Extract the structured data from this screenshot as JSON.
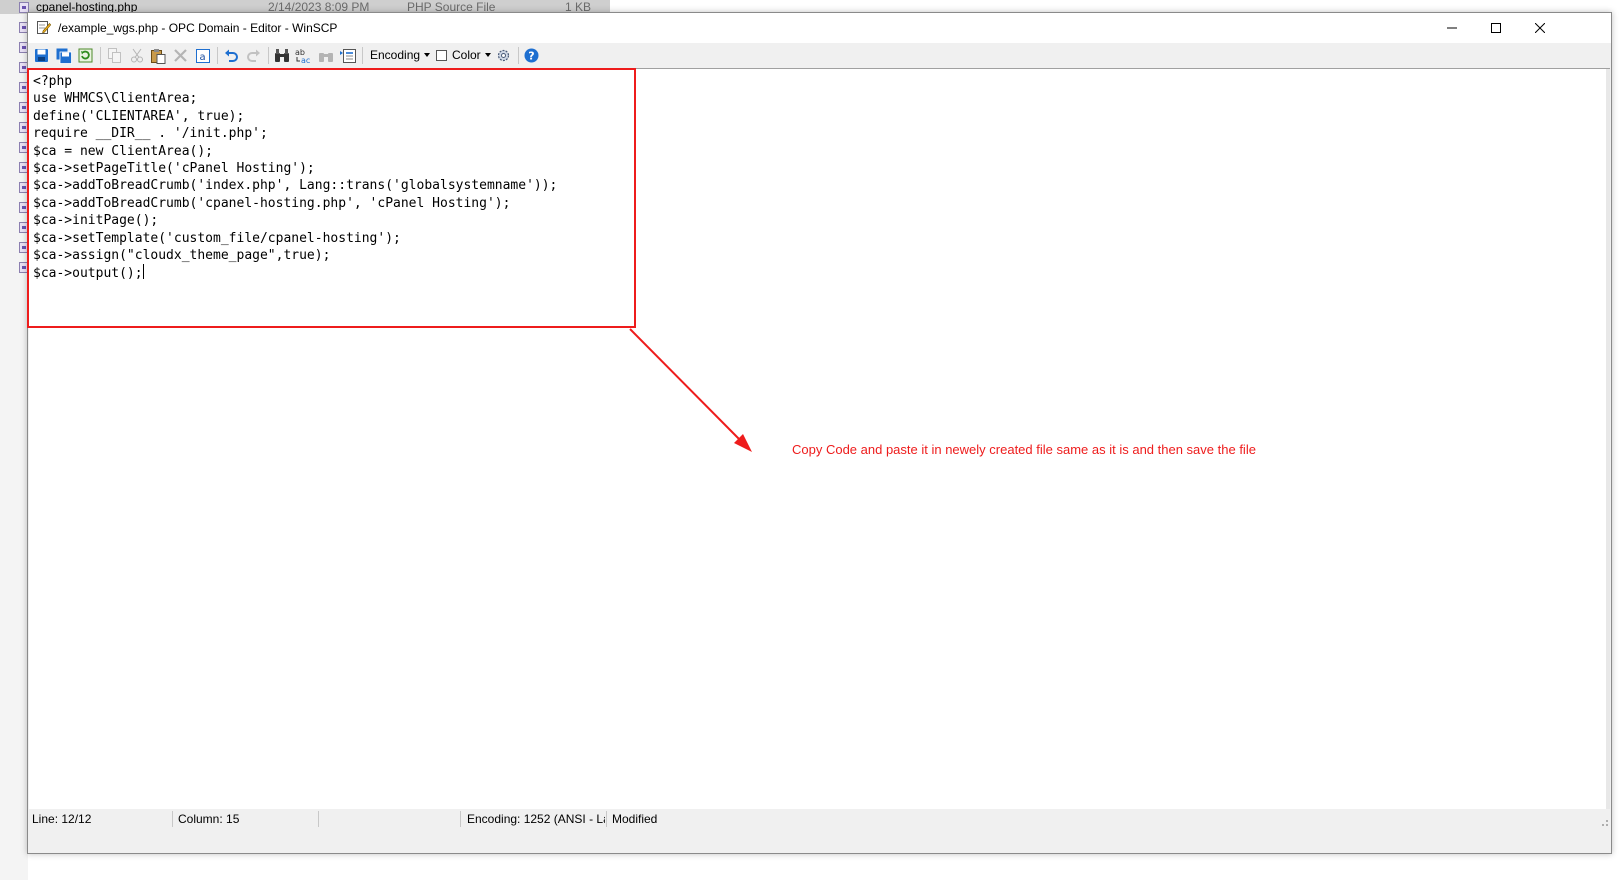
{
  "background_file": {
    "name": "cpanel-hosting.php",
    "modified": "2/14/2023 8:09 PM",
    "type": "PHP Source File",
    "size": "1 KB"
  },
  "window": {
    "title": "/example_wgs.php - OPC Domain - Editor - WinSCP",
    "controls": {
      "minimize": "minimize-icon",
      "maximize": "maximize-icon",
      "close": "close-icon"
    }
  },
  "toolbar": {
    "encoding_label": "Encoding",
    "color_label": "Color",
    "buttons": [
      "save-icon",
      "save-all-icon",
      "reload-icon",
      "copy-icon",
      "cut-icon",
      "paste-icon",
      "delete-icon",
      "select-all-icon",
      "undo-icon",
      "redo-icon",
      "find-icon",
      "replace-icon",
      "find-next-icon",
      "go-to-line-icon",
      "preferences-icon",
      "help-icon"
    ]
  },
  "editor": {
    "lines": [
      "<?php",
      "use WHMCS\\ClientArea;",
      "define('CLIENTAREA', true);",
      "require __DIR__ . '/init.php';",
      "$ca = new ClientArea();",
      "$ca->setPageTitle('cPanel Hosting');",
      "$ca->addToBreadCrumb('index.php', Lang::trans('globalsystemname'));",
      "$ca->addToBreadCrumb('cpanel-hosting.php', 'cPanel Hosting');",
      "$ca->initPage();",
      "$ca->setTemplate('custom_file/cpanel-hosting');",
      "$ca->assign(\"cloudx_theme_page\",true);",
      "$ca->output();"
    ]
  },
  "status": {
    "line": "Line: 12/12",
    "column": "Column: 15",
    "encoding": "Encoding: 1252  (ANSI - La",
    "modified": "Modified"
  },
  "annotation": {
    "text": "Copy Code and paste it in newely created file same as it is and then save the file",
    "color": "#ee1c1c"
  },
  "colors": {
    "accent_blue": "#1e6fd0",
    "annotation_red": "#ee1c1c",
    "chrome": "#f0f0f0"
  }
}
